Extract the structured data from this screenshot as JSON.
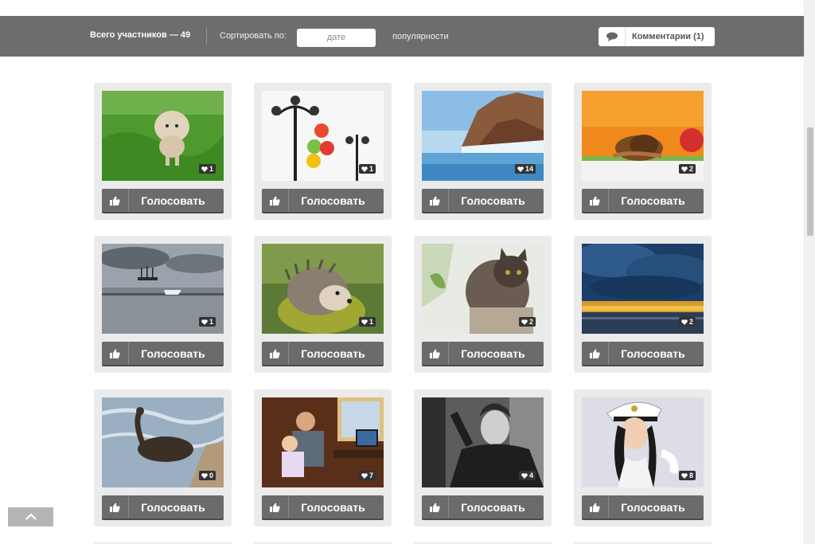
{
  "filter_bar": {
    "participants_label": "Всего участников — 49",
    "sort_label": "Сортировать по:",
    "sort_date": "дате",
    "sort_popularity": "популярности",
    "comments_label": "Комментарии (1)"
  },
  "vote_label": "Голосовать",
  "entries": [
    {
      "photo": "dog",
      "likes": "1"
    },
    {
      "photo": "lamps-balloons",
      "likes": "1"
    },
    {
      "photo": "ice-cliff",
      "likes": "14"
    },
    {
      "photo": "snail-apple",
      "likes": "2"
    },
    {
      "photo": "sailing-ship",
      "likes": "1"
    },
    {
      "photo": "hedgehog",
      "likes": "1"
    },
    {
      "photo": "cat",
      "likes": "2"
    },
    {
      "photo": "storm-sky",
      "likes": "2"
    },
    {
      "photo": "cormorant",
      "likes": "0"
    },
    {
      "photo": "father-child-computer",
      "likes": "7"
    },
    {
      "photo": "young-man-portrait",
      "likes": "4"
    },
    {
      "photo": "woman-captain-hat",
      "likes": "8"
    }
  ],
  "colors": {
    "bar": "#6e6d6c",
    "card": "#ebebeb",
    "button": "#6b6b6b"
  }
}
